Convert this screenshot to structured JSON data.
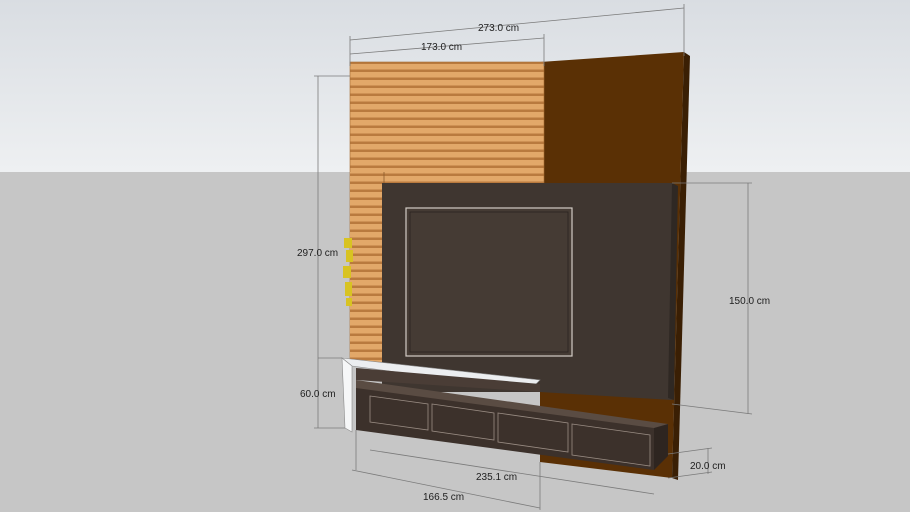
{
  "scene": {
    "colors": {
      "sky_top": "#d9dde2",
      "sky_bottom": "#eef0f2",
      "ground": "#c6c6c6",
      "slat_light": "#e2a869",
      "slat_dark": "#b97a3e",
      "brown_panel": "#5a3005",
      "tv_panel": "#3f3630",
      "tv_screen": "#453b34",
      "shelf": "#eceef0",
      "cabinet": "#3c312b",
      "dimension_line": "#7a7a7a",
      "accent_yellow": "#d8c322"
    },
    "dimensions": {
      "total_width": "273.0 cm",
      "slat_width": "173.0 cm",
      "total_height": "297.0 cm",
      "panel_height": "150.0 cm",
      "cabinet_height": "60.0 cm",
      "cabinet_depth": "20.0 cm",
      "cabinet_width": "235.1 cm",
      "shelf_width": "166.5 cm"
    }
  }
}
